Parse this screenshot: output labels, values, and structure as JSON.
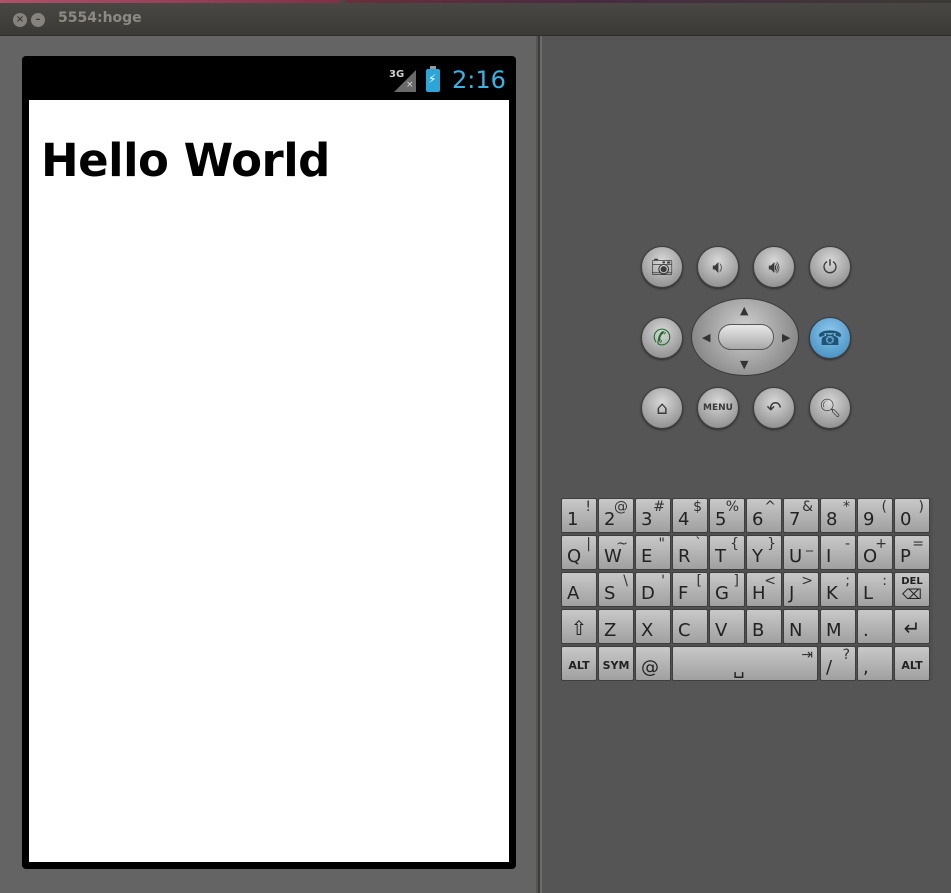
{
  "window": {
    "title": "5554:hoge"
  },
  "status_bar": {
    "network": "3G",
    "time": "2:16"
  },
  "app": {
    "text": "Hello World"
  },
  "hardware_buttons": {
    "camera": "camera-icon",
    "volume_down": "volume-down-icon",
    "volume_up": "volume-up-icon",
    "power": "power-icon",
    "call": "call-icon",
    "end_call": "end-call-icon",
    "home": "home-icon",
    "menu_label": "MENU",
    "back": "back-icon",
    "search": "search-icon"
  },
  "keyboard": {
    "row1": [
      {
        "main": "1",
        "alt": "!"
      },
      {
        "main": "2",
        "alt": "@"
      },
      {
        "main": "3",
        "alt": "#"
      },
      {
        "main": "4",
        "alt": "$"
      },
      {
        "main": "5",
        "alt": "%"
      },
      {
        "main": "6",
        "alt": "^"
      },
      {
        "main": "7",
        "alt": "&"
      },
      {
        "main": "8",
        "alt": "*"
      },
      {
        "main": "9",
        "alt": "("
      },
      {
        "main": "0",
        "alt": ")"
      }
    ],
    "row2": [
      {
        "main": "Q",
        "alt": "|"
      },
      {
        "main": "W",
        "alt": "~"
      },
      {
        "main": "E",
        "alt": "\""
      },
      {
        "main": "R",
        "alt": "`"
      },
      {
        "main": "T",
        "alt": "{"
      },
      {
        "main": "Y",
        "alt": "}"
      },
      {
        "main": "U",
        "alt": "_"
      },
      {
        "main": "I",
        "alt": "-"
      },
      {
        "main": "O",
        "alt": "+"
      },
      {
        "main": "P",
        "alt": "="
      }
    ],
    "row3": [
      {
        "main": "A",
        "alt": ""
      },
      {
        "main": "S",
        "alt": "\\"
      },
      {
        "main": "D",
        "alt": "'"
      },
      {
        "main": "F",
        "alt": "["
      },
      {
        "main": "G",
        "alt": "]"
      },
      {
        "main": "H",
        "alt": "<"
      },
      {
        "main": "J",
        "alt": ">"
      },
      {
        "main": "K",
        "alt": ";"
      },
      {
        "main": "L",
        "alt": ":"
      }
    ],
    "del_label": "DEL",
    "row4": [
      {
        "main": "Z",
        "alt": ""
      },
      {
        "main": "X",
        "alt": ""
      },
      {
        "main": "C",
        "alt": ""
      },
      {
        "main": "V",
        "alt": ""
      },
      {
        "main": "B",
        "alt": ""
      },
      {
        "main": "N",
        "alt": ""
      },
      {
        "main": "M",
        "alt": ""
      },
      {
        "main": ".",
        "alt": ""
      }
    ],
    "alt_label": "ALT",
    "sym_label": "SYM",
    "at": "@",
    "slash": {
      "main": "/",
      "alt": "?"
    },
    "comma": ","
  }
}
